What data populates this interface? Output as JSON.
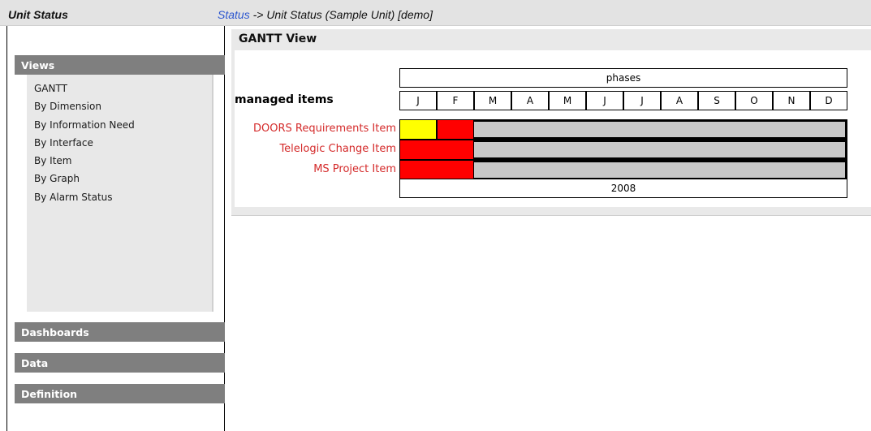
{
  "header": {
    "app_title": "Unit Status",
    "breadcrumb_link": "Status",
    "breadcrumb_rest": " -> Unit Status (Sample Unit) [demo]"
  },
  "sidebar": {
    "views_title": "Views",
    "views_items": [
      {
        "label": "GANTT"
      },
      {
        "label": "By Dimension"
      },
      {
        "label": "By Information Need"
      },
      {
        "label": "By Interface"
      },
      {
        "label": "By Item"
      },
      {
        "label": "By Graph"
      },
      {
        "label": "By Alarm Status"
      }
    ],
    "dashboards_title": "Dashboards",
    "data_title": "Data",
    "definition_title": "Definition"
  },
  "main": {
    "title": "GANTT View",
    "gantt": {
      "phases_label": "phases",
      "items_header": "managed items",
      "year": "2008",
      "months": [
        "J",
        "F",
        "M",
        "A",
        "M",
        "J",
        "J",
        "A",
        "S",
        "O",
        "N",
        "D"
      ],
      "items": [
        {
          "label": "DOORS Requirements Item",
          "segments": [
            {
              "start": 0,
              "span": 1,
              "color": "#ffff00"
            },
            {
              "start": 1,
              "span": 1,
              "color": "#ff0000"
            }
          ]
        },
        {
          "label": "Telelogic Change Item",
          "segments": [
            {
              "start": 0,
              "span": 2,
              "color": "#ff0000"
            }
          ]
        },
        {
          "label": "MS Project Item",
          "segments": [
            {
              "start": 0,
              "span": 2,
              "color": "#ff0000"
            }
          ]
        }
      ],
      "empty_color": "#c8c8c8"
    }
  }
}
